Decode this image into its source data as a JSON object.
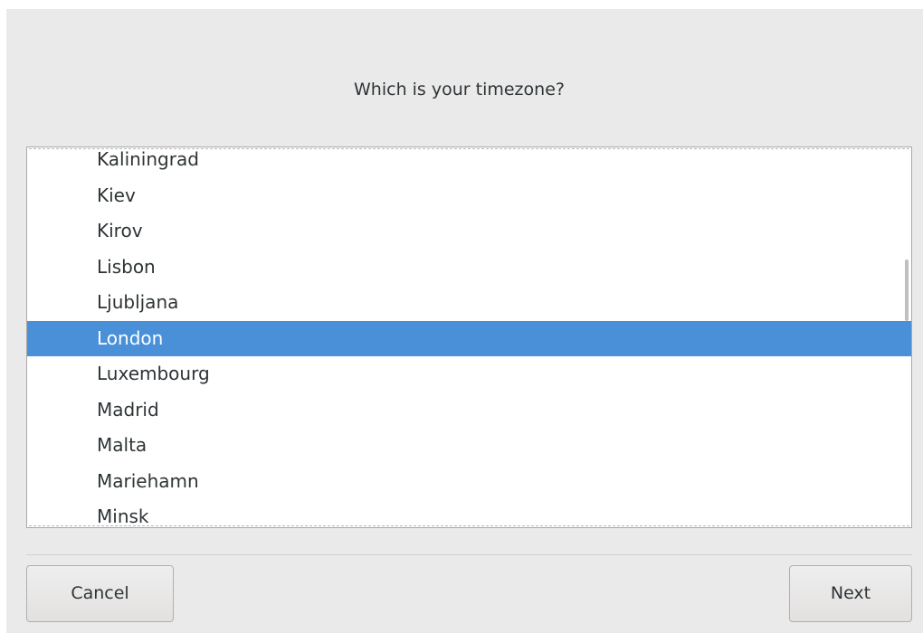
{
  "dialog": {
    "question": "Which is your timezone?"
  },
  "timezone_list": {
    "items": [
      "Kaliningrad",
      "Kiev",
      "Kirov",
      "Lisbon",
      "Ljubljana",
      "London",
      "Luxembourg",
      "Madrid",
      "Malta",
      "Mariehamn",
      "Minsk"
    ],
    "selected": "London",
    "selected_color": "#4a90d9"
  },
  "buttons": {
    "cancel_label": "Cancel",
    "next_label": "Next"
  }
}
